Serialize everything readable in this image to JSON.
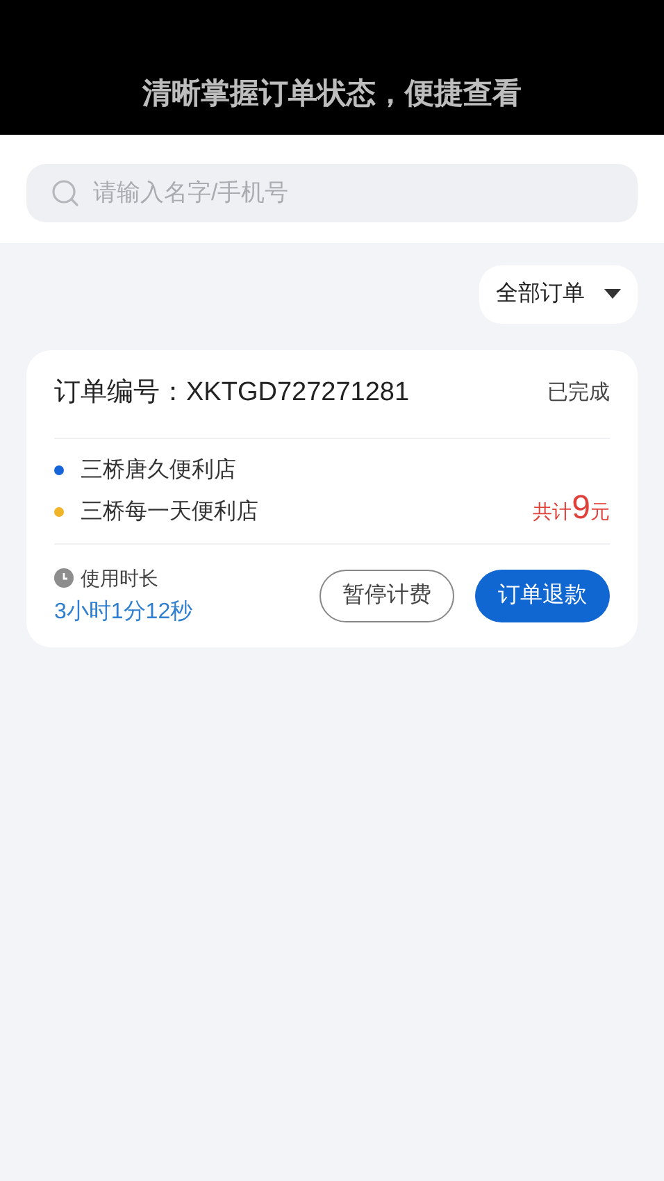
{
  "caption": "清晰掌握订单状态，便捷查看",
  "search": {
    "placeholder": "请输入名字/手机号"
  },
  "filter": {
    "label": "全部订单"
  },
  "orders": [
    {
      "number_label": "订单编号：",
      "number": "XKTGD727271281",
      "status": "已完成",
      "stores": [
        {
          "name": "三桥唐久便利店",
          "color": "#1565d8"
        },
        {
          "name": "三桥每一天便利店",
          "color": "#f0b429"
        }
      ],
      "total_prefix": "共计",
      "total_amount": "9",
      "total_unit": "元",
      "duration_label": "使用时长",
      "duration": "3小时1分12秒",
      "buttons": [
        {
          "label": "暂停计费",
          "kind": "outline"
        },
        {
          "label": "订单退款",
          "kind": "primary"
        }
      ]
    }
  ]
}
